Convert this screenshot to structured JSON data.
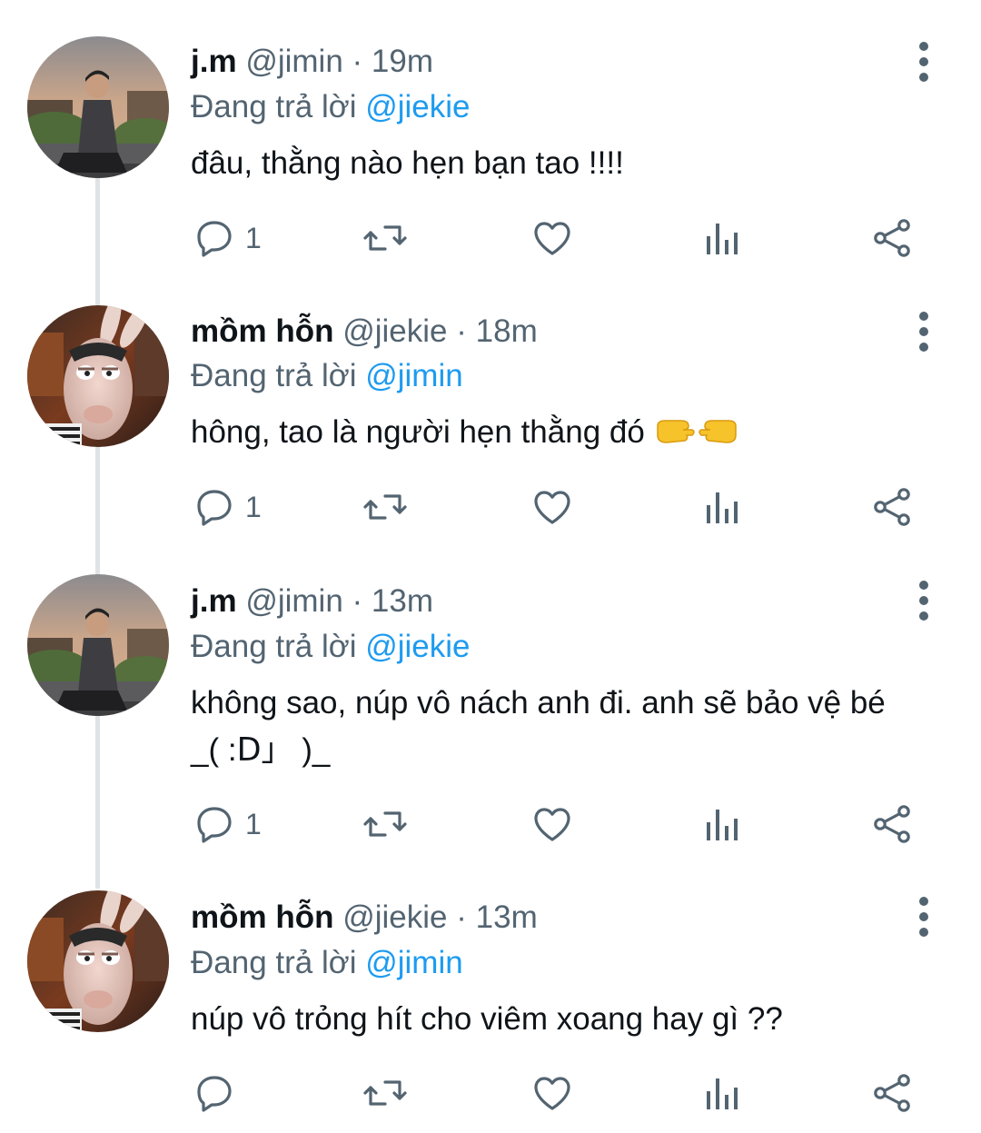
{
  "tweets": [
    {
      "name": "j.m",
      "handle": "@jimin",
      "dot": "·",
      "time": "19m",
      "reply_prefix": "Đang trả lời",
      "reply_to": "@jiekie",
      "text_line1": "đâu, thằng nào hẹn bạn tao !!!!",
      "text_line2": "",
      "reply_count": "1",
      "avatar": "man-on-rooftop-avatar"
    },
    {
      "name": "mồm hỗn",
      "handle": "@jiekie",
      "dot": "·",
      "time": "18m",
      "reply_prefix": "Đang trả lời",
      "reply_to": "@jimin",
      "text_line1": "hông, tao là người hẹn thằng đó",
      "text_line2": "",
      "emoji": "pointing-hands-emoji",
      "reply_count": "1",
      "avatar": "rabbid-avatar"
    },
    {
      "name": "j.m",
      "handle": "@jimin",
      "dot": "·",
      "time": "13m",
      "reply_prefix": "Đang trả lời",
      "reply_to": "@jiekie",
      "text_line1": "không sao, núp vô nách anh đi. anh sẽ bảo vệ bé",
      "text_line2": "_( :ᗞ」 )_",
      "reply_count": "1",
      "avatar": "man-on-rooftop-avatar"
    },
    {
      "name": "mồm hỗn",
      "handle": "@jiekie",
      "dot": "·",
      "time": "13m",
      "reply_prefix": "Đang trả lời",
      "reply_to": "@jimin",
      "text_line1": "núp vô trỏng hít cho viêm xoang hay gì ??",
      "text_line2": "",
      "reply_count": "",
      "avatar": "rabbid-avatar"
    }
  ],
  "icons": {
    "reply": "reply-bubble-icon",
    "retweet": "retweet-icon",
    "like": "heart-icon",
    "views": "analytics-icon",
    "share": "share-icon",
    "more": "more-vertical-icon"
  },
  "colors": {
    "text": "#0f1419",
    "muted": "#536471",
    "link": "#1d9bf0",
    "thread_line": "#dfe3e6"
  }
}
